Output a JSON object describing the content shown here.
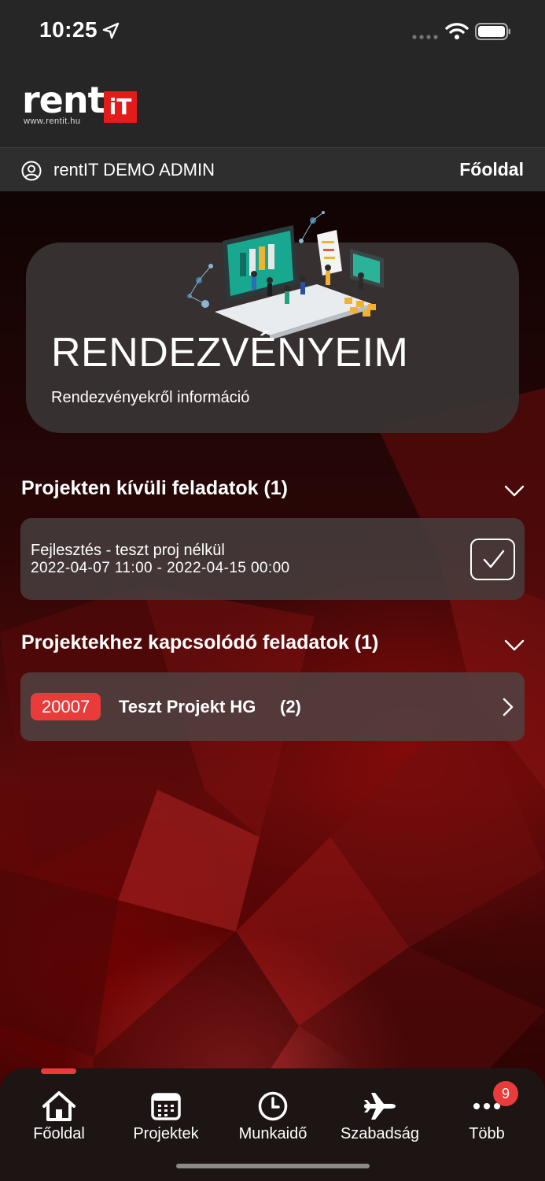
{
  "status_bar": {
    "time": "10:25",
    "icons": [
      "location-arrow-icon",
      "signal-icon",
      "wifi-icon",
      "battery-icon"
    ]
  },
  "header": {
    "logo_text": "rent",
    "logo_badge": "iT",
    "logo_url": "www.rentit.hu",
    "user_name": "rentIT DEMO ADMIN",
    "home_link": "Főoldal"
  },
  "hero": {
    "title": "RENDEZVÉNYEIM",
    "subtitle": "Rendezvényekről információ"
  },
  "sections": {
    "outside_tasks": {
      "title": "Projekten kívüli feladatok (1)",
      "tasks": [
        {
          "title": "Fejlesztés - teszt proj nélkül",
          "date": "2022-04-07 11:00 - 2022-04-15 00:00"
        }
      ]
    },
    "project_tasks": {
      "title": "Projektekhez kapcsolódó feladatok (1)",
      "projects": [
        {
          "id": "20007",
          "name": "Teszt Projekt HG",
          "count": "(2)"
        }
      ]
    }
  },
  "bottom_nav": {
    "items": [
      {
        "label": "Főoldal",
        "icon": "home-icon",
        "active": true
      },
      {
        "label": "Projektek",
        "icon": "calendar-icon"
      },
      {
        "label": "Munkaidő",
        "icon": "clock-icon"
      },
      {
        "label": "Szabadság",
        "icon": "airplane-icon"
      },
      {
        "label": "Több",
        "icon": "more-dots-icon",
        "badge": "9"
      }
    ]
  },
  "colors": {
    "accent": "#ea3b3b",
    "header_bg": "#262626"
  }
}
